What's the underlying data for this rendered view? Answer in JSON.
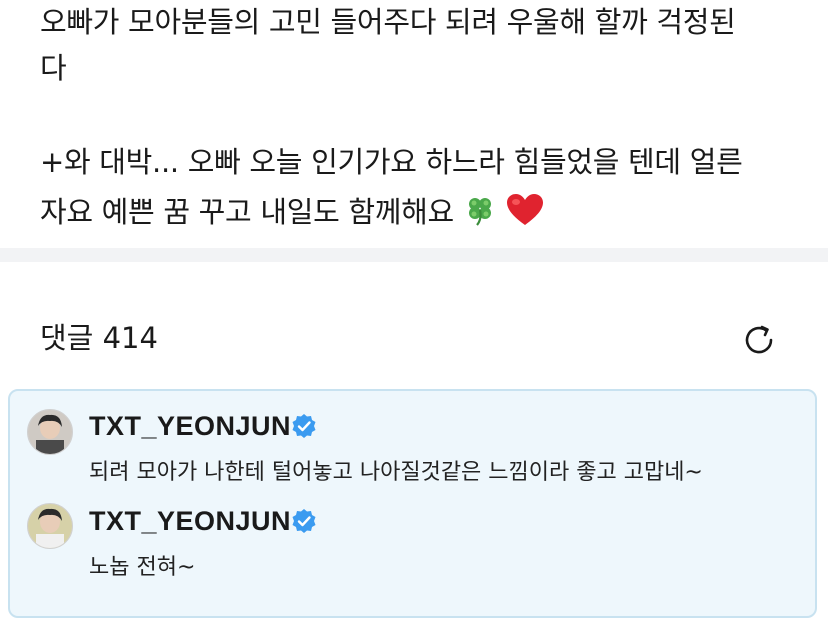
{
  "post": {
    "line1": "오빠가 모아분들의 고민 들어주다 되려 우울해 할까 걱정된",
    "line2": "다",
    "line3": "+와 대박... 오빠 오늘 인기가요 하느라 힘들었을 텐데 얼른",
    "line4": "자요 예쁜 꿈 꾸고 내일도 함께해요",
    "emoji_1": "four-leaf-clover-icon",
    "emoji_2": "red-heart-icon"
  },
  "comments": {
    "header": "댓글 414",
    "refresh_icon": "refresh-icon"
  },
  "replies": [
    {
      "author": "TXT_YEONJUN",
      "verified": true,
      "text": "되려 모아가 나한테 털어놓고 나아질것같은 느낌이라 좋고 고맙네~"
    },
    {
      "author": "TXT_YEONJUN",
      "verified": true,
      "text": "노놉 전혀~"
    }
  ],
  "colors": {
    "reply_bg": "#eef7fc",
    "reply_border": "#c8e2f0",
    "verified_blue": "#3b9bf0",
    "divider": "#f2f3f5"
  }
}
